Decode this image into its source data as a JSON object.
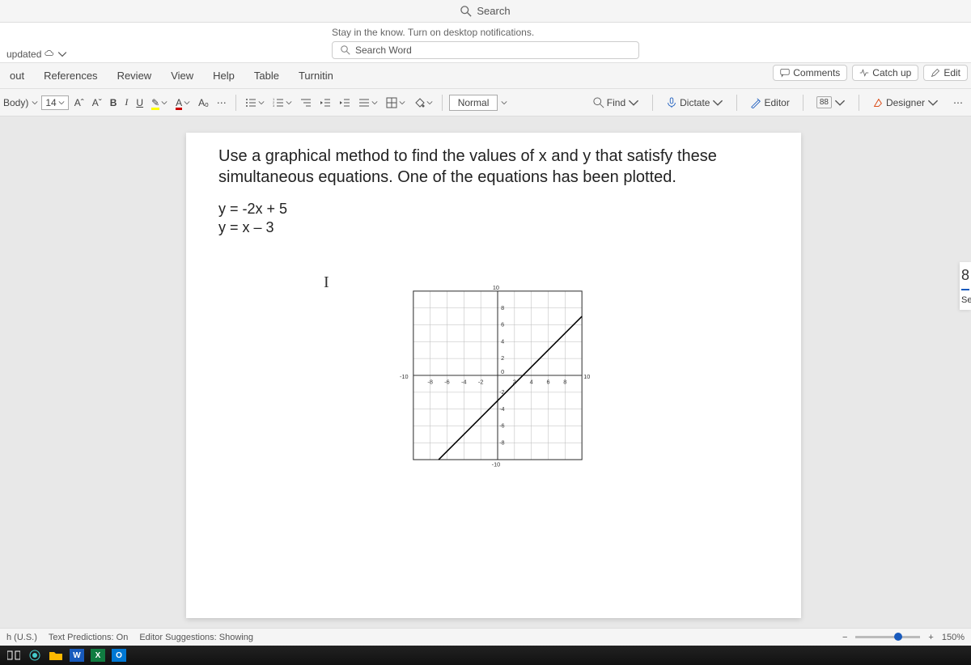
{
  "title_search": "Search",
  "notification": "Stay in the know. Turn on desktop notifications.",
  "search_placeholder": "Search Word",
  "updated_label": "updated",
  "tabs": {
    "out": "out",
    "references": "References",
    "review": "Review",
    "view": "View",
    "help": "Help",
    "table": "Table",
    "turnitin": "Turnitin"
  },
  "actions": {
    "comments": "Comments",
    "catchup": "Catch up",
    "edit": "Edit"
  },
  "toolbar": {
    "font_label": "Body)",
    "font_size": "14",
    "grow": "Aˆ",
    "shrink": "Aˇ",
    "bold": "B",
    "italic": "I",
    "underline": "U",
    "highlight": "✎",
    "fontcolor": "A",
    "clear": "Aₒ",
    "more": "⋯",
    "style": "Normal",
    "find": "Find",
    "dictate": "Dictate",
    "editor": "Editor",
    "designer": "Designer"
  },
  "document": {
    "question": "Use a graphical method to find the values of x and y that satisfy these simultaneous equations. One of the equations has been plotted.",
    "eq1": "y = -2x + 5",
    "eq2": "y = x – 3"
  },
  "side": {
    "num": "8",
    "sec": "Se"
  },
  "status": {
    "lang": "h (U.S.)",
    "predictions": "Text Predictions: On",
    "suggestions": "Editor Suggestions: Showing",
    "zoom_minus": "−",
    "zoom_plus": "+",
    "zoom": "150%"
  },
  "chart_data": {
    "type": "line",
    "title": "",
    "xlabel": "",
    "ylabel": "",
    "xlim": [
      -10,
      10
    ],
    "ylim": [
      -10,
      10
    ],
    "x_ticks": [
      -10,
      -8,
      -6,
      -4,
      -2,
      0,
      2,
      4,
      6,
      8,
      10
    ],
    "y_ticks": [
      -10,
      -8,
      -6,
      -4,
      -2,
      0,
      2,
      4,
      6,
      8,
      10
    ],
    "series": [
      {
        "name": "y = x - 3",
        "points": [
          [
            -7,
            -10
          ],
          [
            10,
            7
          ]
        ]
      }
    ]
  }
}
